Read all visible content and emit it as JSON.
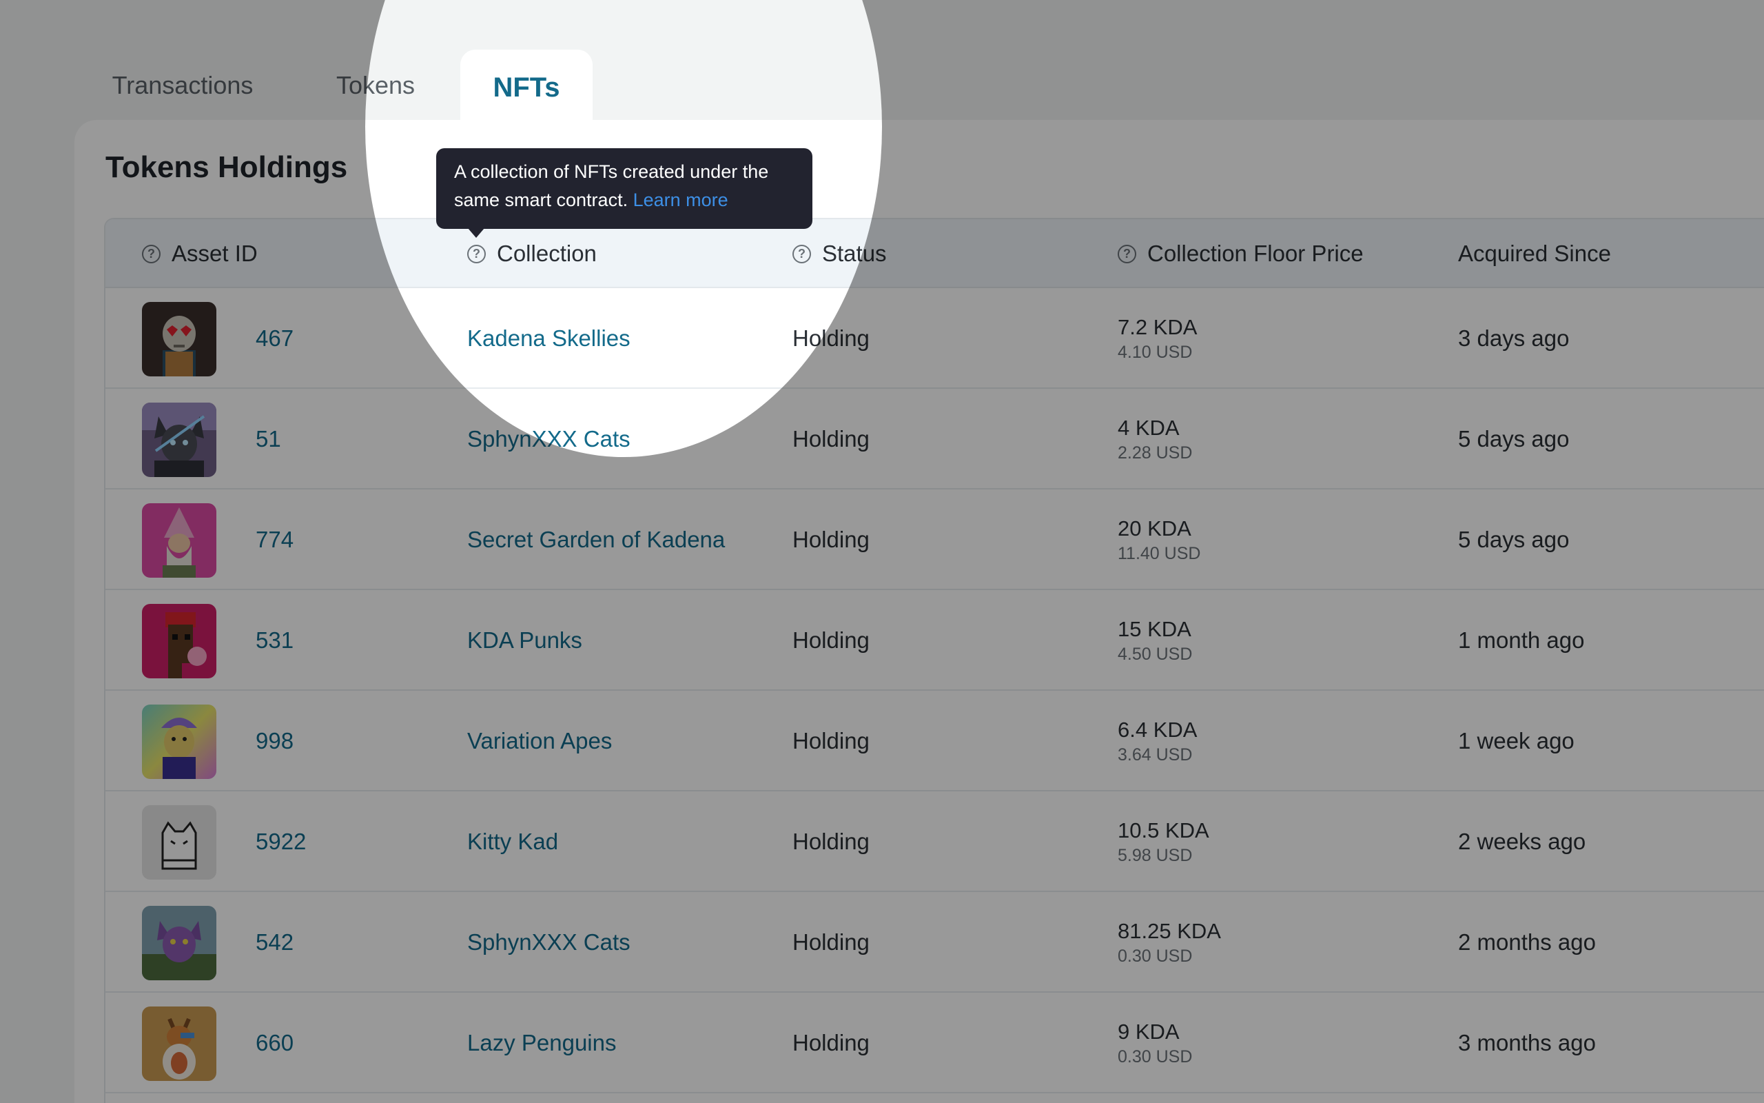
{
  "tabs": [
    {
      "label": "Transactions"
    },
    {
      "label": "Tokens"
    },
    {
      "label": "NFTs"
    }
  ],
  "card": {
    "title": "Tokens Holdings"
  },
  "columns": {
    "asset_id": "Asset ID",
    "collection": "Collection",
    "status": "Status",
    "floor_price": "Collection Floor Price",
    "acquired": "Acquired Since"
  },
  "tooltip": {
    "text": "A collection of NFTs created under the same smart contract.",
    "link": "Learn more"
  },
  "rows": [
    {
      "asset_id": "467",
      "collection": "Kadena Skellies",
      "status": "Holding",
      "kda": "7.2 KDA",
      "usd": "4.10 USD",
      "acquired": "3 days ago",
      "avatar": "skull-avatar"
    },
    {
      "asset_id": "51",
      "collection": "SphynXXX Cats",
      "status": "Holding",
      "kda": "4 KDA",
      "usd": "2.28 USD",
      "acquired": "5 days ago",
      "avatar": "sphynx-cat-avatar"
    },
    {
      "asset_id": "774",
      "collection": "Secret Garden of Kadena",
      "status": "Holding",
      "kda": "20 KDA",
      "usd": "11.40 USD",
      "acquired": "5 days ago",
      "avatar": "gnome-avatar"
    },
    {
      "asset_id": "531",
      "collection": "KDA Punks",
      "status": "Holding",
      "kda": "15 KDA",
      "usd": "4.50 USD",
      "acquired": "1 month ago",
      "avatar": "punk-avatar"
    },
    {
      "asset_id": "998",
      "collection": "Variation Apes",
      "status": "Holding",
      "kda": "6.4 KDA",
      "usd": "3.64 USD",
      "acquired": "1 week ago",
      "avatar": "ape-avatar"
    },
    {
      "asset_id": "5922",
      "collection": "Kitty Kad",
      "status": "Holding",
      "kda": "10.5 KDA",
      "usd": "5.98 USD",
      "acquired": "2 weeks ago",
      "avatar": "kitty-avatar"
    },
    {
      "asset_id": "542",
      "collection": "SphynXXX Cats",
      "status": "Holding",
      "kda": "81.25 KDA",
      "usd": "0.30 USD",
      "acquired": "2 months ago",
      "avatar": "purple-cat-avatar"
    },
    {
      "asset_id": "660",
      "collection": "Lazy Penguins",
      "status": "Holding",
      "kda": "9 KDA",
      "usd": "0.30 USD",
      "acquired": "3 months ago",
      "avatar": "penguin-avatar"
    }
  ],
  "colors": {
    "accent": "#136a8a",
    "tooltip_bg": "#22232f",
    "link": "#3d8fe6",
    "header_bg": "#eff4f8"
  }
}
